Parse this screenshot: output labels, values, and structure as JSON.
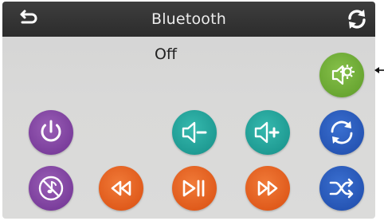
{
  "header": {
    "title": "Bluetooth",
    "back_icon": "back-arrow-icon",
    "refresh_icon": "refresh-icon"
  },
  "status": {
    "text": "Off"
  },
  "buttons": {
    "settings": {
      "icon": "speaker-gear-icon",
      "color": "#69a632"
    },
    "power": {
      "icon": "power-icon",
      "color": "#7b3e9c"
    },
    "volume_down": {
      "icon": "speaker-minus-icon",
      "color": "#1f9b93"
    },
    "volume_up": {
      "icon": "speaker-plus-icon",
      "color": "#1f9b93"
    },
    "repeat": {
      "icon": "repeat-icon",
      "color": "#2655b4"
    },
    "mute": {
      "icon": "music-off-icon",
      "color": "#7b3e9c"
    },
    "previous": {
      "icon": "rewind-icon",
      "color": "#e05b1c"
    },
    "play_pause": {
      "icon": "play-pause-icon",
      "color": "#e05b1c"
    },
    "next": {
      "icon": "fast-forward-icon",
      "color": "#e05b1c"
    },
    "shuffle": {
      "icon": "shuffle-icon",
      "color": "#2655b4"
    }
  },
  "colors": {
    "header_bg": "#2c2c2c",
    "screen_bg": "#d9d9d8",
    "title_text": "#ececec",
    "status_text": "#222222"
  }
}
